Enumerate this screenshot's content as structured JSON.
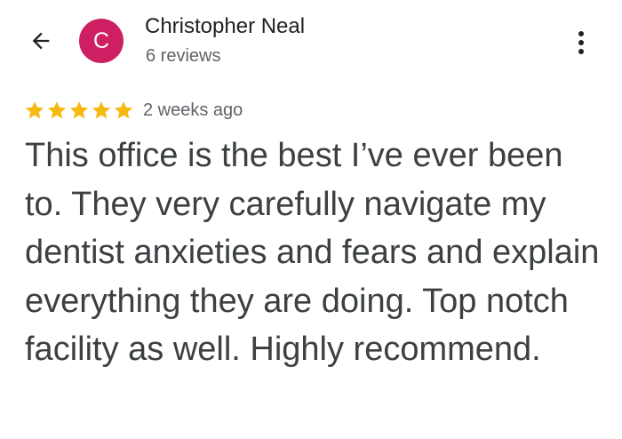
{
  "header": {
    "back_icon": "arrow-left-icon",
    "avatar_letter": "C",
    "avatar_color": "#cf1f63",
    "author_name": "Christopher Neal",
    "review_count": "6 reviews",
    "more_icon": "more-vertical-icon"
  },
  "review": {
    "rating": 5,
    "rating_max": 5,
    "star_color": "#f6b90f",
    "date": "2 weeks ago",
    "text": "This office is the best I’ve ever been to.  They very carefully navigate my dentist anxieties and fears and explain everything they are doing.  Top notch facility as well.  Highly recommend."
  }
}
